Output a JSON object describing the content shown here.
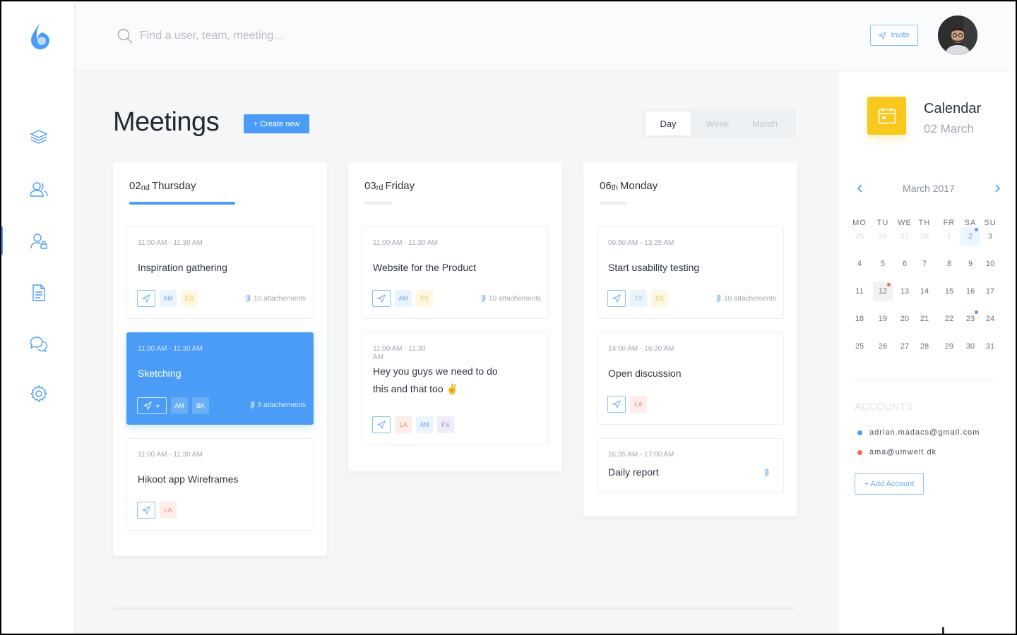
{
  "search": {
    "placeholder": "Find a user, team, meeting..."
  },
  "header": {
    "invite_label": "Invite"
  },
  "main": {
    "title": "Meetings",
    "create_label": "+ Create new",
    "views": [
      "Day",
      "Week",
      "Month"
    ],
    "active_view": "Day"
  },
  "columns": [
    {
      "date_num": "02",
      "date_suffix": "nd",
      "weekday": "Thursday",
      "cards": [
        {
          "time": "11:00 AM - 11:30 AM",
          "title": "Inspiration gathering",
          "chips": [
            "AM",
            "ES"
          ],
          "attachments": "10 attachements"
        },
        {
          "time": "11:00 AM - 11:30 AM",
          "title": "Sketching",
          "chips": [
            "AM",
            "BK"
          ],
          "attachments": "3 attachements",
          "send_extra": "+"
        },
        {
          "time": "11:00 AM - 11:30 AM",
          "title": "Hikoot app Wireframes",
          "chips": [
            "LA"
          ]
        }
      ]
    },
    {
      "date_num": "03",
      "date_suffix": "rd",
      "weekday": "Friday",
      "cards": [
        {
          "time": "11:00 AM - 11:30 AM",
          "title": "Website for the Product",
          "chips": [
            "AM",
            "ES"
          ],
          "attachments": "10 attachements"
        },
        {
          "time": "11:00 AM - 11:30 AM",
          "title": "Hey you guys we need to do this and that too ✌",
          "chips": [
            "LA",
            "AM",
            "FS"
          ]
        }
      ]
    },
    {
      "date_num": "06",
      "date_suffix": "th",
      "weekday": "Monday",
      "cards": [
        {
          "time": "09:50 AM - 13:25 AM",
          "title": "Start usability testing",
          "chips": [
            "TX",
            "ES"
          ],
          "attachments": "10 attachements"
        },
        {
          "time": "14:00 AM - 16:30 AM",
          "title": "Open discussion",
          "chips": [
            "LA"
          ]
        },
        {
          "time": "16:35 AM - 17:00 AM",
          "title": "Daily report"
        }
      ]
    }
  ],
  "calendar": {
    "title": "Calendar",
    "date": "02 March",
    "month_label": "March 2017",
    "weekdays": [
      "MO",
      "TU",
      "WE",
      "TH",
      "FR",
      "SA",
      "SU"
    ],
    "weeks": [
      [
        "25",
        "26",
        "27",
        "28",
        "1",
        "2",
        "3"
      ],
      [
        "4",
        "5",
        "6",
        "7",
        "8",
        "9",
        "10"
      ],
      [
        "11",
        "12",
        "13",
        "14",
        "15",
        "16",
        "17"
      ],
      [
        "18",
        "19",
        "20",
        "21",
        "22",
        "23",
        "24"
      ],
      [
        "25",
        "26",
        "27",
        "28",
        "29",
        "30",
        "31"
      ]
    ]
  },
  "accounts": {
    "title": "ACCOUNTS",
    "items": [
      {
        "email": "adrian.madacs@gmail.com",
        "color": "#4a9cf6"
      },
      {
        "email": "ama@umwelt.dk",
        "color": "#ef6c52"
      }
    ],
    "add_label": "+ Add Account"
  },
  "colors": {
    "accent": "#4a9cf6",
    "calendar_badge": "#f8c81c",
    "alert": "#ef6c52"
  }
}
